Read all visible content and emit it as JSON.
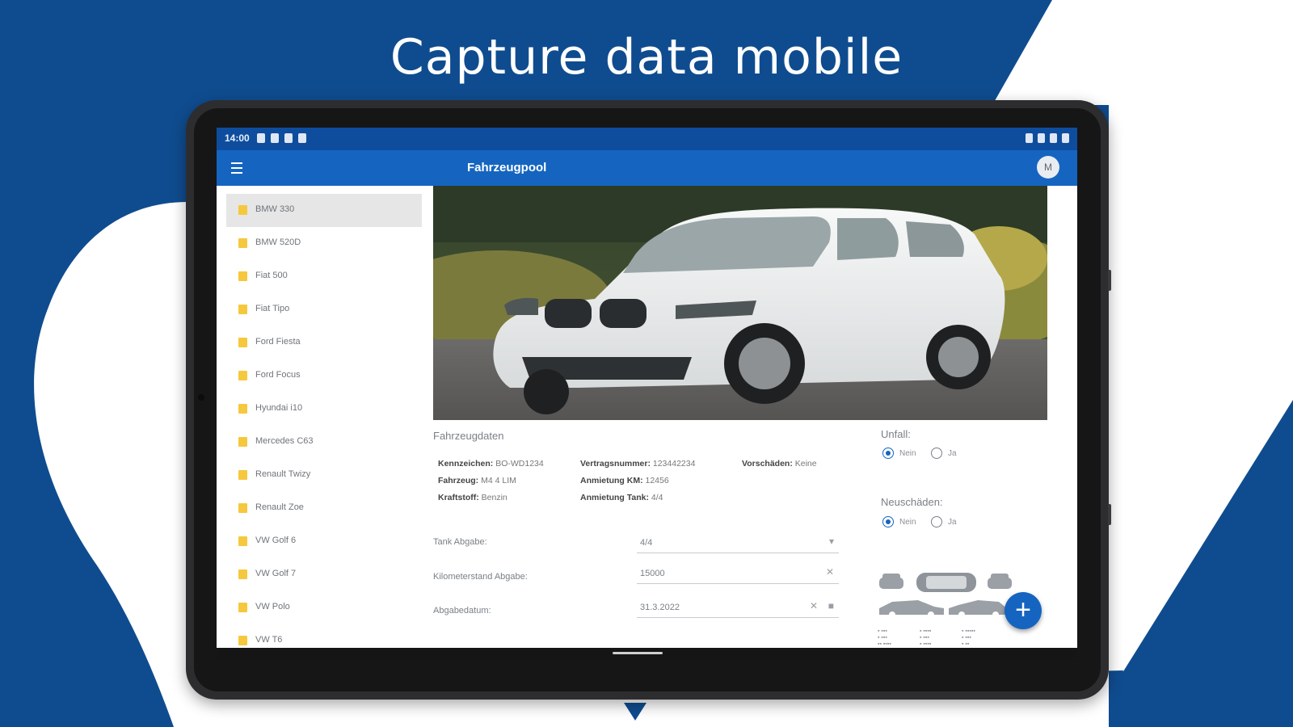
{
  "headline": "Capture data mobile",
  "colors": {
    "brand_navy": "#0f4c8f",
    "app_blue": "#1565c0",
    "status_blue": "#0e4d9e",
    "folder_yellow": "#f6c83d"
  },
  "status_bar": {
    "time": "14:00"
  },
  "app_bar": {
    "title": "Fahrzeugpool",
    "menu_icon": "hamburger-menu-icon",
    "avatar_initial": "M"
  },
  "vehicle_list": [
    {
      "label": "BMW 330",
      "selected": true
    },
    {
      "label": "BMW 520D"
    },
    {
      "label": "Fiat 500"
    },
    {
      "label": "Fiat Tipo"
    },
    {
      "label": "Ford Fiesta"
    },
    {
      "label": "Ford Focus"
    },
    {
      "label": "Hyundai i10"
    },
    {
      "label": "Mercedes C63"
    },
    {
      "label": "Renault Twizy"
    },
    {
      "label": "Renault Zoe"
    },
    {
      "label": "VW Golf 6"
    },
    {
      "label": "VW Golf 7"
    },
    {
      "label": "VW Polo"
    },
    {
      "label": "VW T6"
    }
  ],
  "vehicle_data": {
    "section_title": "Fahrzeugdaten",
    "fields": [
      {
        "label": "Kennzeichen:",
        "value": "BO-WD1234"
      },
      {
        "label": "Vertragsnummer:",
        "value": "123442234"
      },
      {
        "label": "Vorschäden:",
        "value": "Keine"
      },
      {
        "label": "Fahrzeug:",
        "value": "M4 4 LIM"
      },
      {
        "label": "Anmietung KM:",
        "value": "12456"
      },
      {
        "label": "Kraftstoff:",
        "value": "Benzin"
      },
      {
        "label": "Anmietung Tank:",
        "value": "4/4"
      }
    ]
  },
  "form": {
    "tank": {
      "label": "Tank Abgabe:",
      "value": "4/4",
      "icon": "dropdown-arrow-icon"
    },
    "km": {
      "label": "Kilometerstand Abgabe:",
      "value": "15000",
      "icon": "clear-icon"
    },
    "date": {
      "label": "Abgabedatum:",
      "value": "31.3.2022",
      "icon": "calendar-icon"
    }
  },
  "unfall": {
    "label": "Unfall:",
    "options": [
      "Nein",
      "Ja"
    ],
    "selected": "Nein"
  },
  "neuschaeden": {
    "label": "Neuschäden:",
    "options": [
      "Nein",
      "Ja"
    ],
    "selected": "Nein"
  },
  "fab": {
    "label": "+",
    "icon": "add-icon"
  }
}
